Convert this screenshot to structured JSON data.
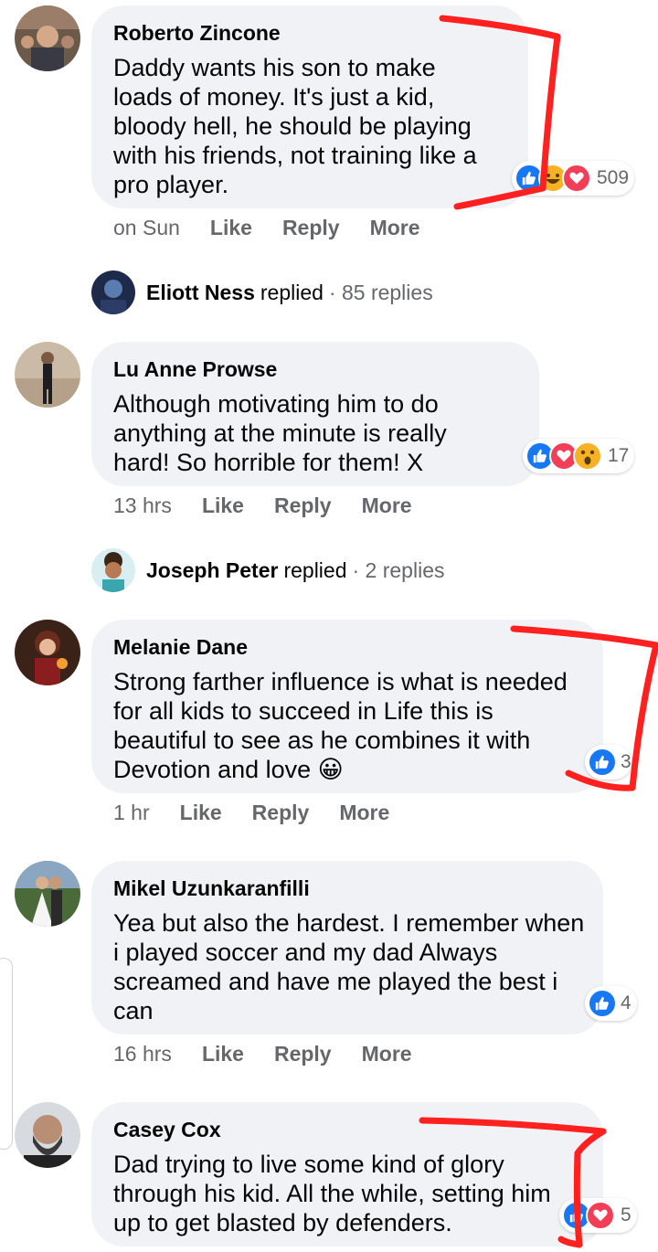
{
  "actions": {
    "like": "Like",
    "reply": "Reply",
    "more": "More"
  },
  "comments": [
    {
      "name": "Roberto Zincone",
      "text": "Daddy wants his son to make loads of money. It's just a kid, bloody hell, he should be playing with his friends, not training like a pro player.",
      "time": "on Sun",
      "reactions": [
        "like-icon",
        "haha-icon",
        "love-icon"
      ],
      "reaction_count": "509"
    },
    {
      "name": "Lu Anne Prowse",
      "text": "Although motivating him to do anything at the minute is really hard! So horrible for them! X",
      "time": "13 hrs",
      "reactions": [
        "like-icon",
        "love-icon",
        "wow-icon"
      ],
      "reaction_count": "17"
    },
    {
      "name": "Melanie Dane",
      "text": "Strong farther influence is what is needed for all kids to succeed in Life this is beautiful to see as he combines it with Devotion and love 😀",
      "time": "1 hr",
      "reactions": [
        "like-icon"
      ],
      "reaction_count": "3"
    },
    {
      "name": "Mikel Uzunkaranfilli",
      "text": "Yea but also the hardest. I remember when i played soccer and my dad Always screamed and have me played the best i can",
      "time": "16 hrs",
      "reactions": [
        "like-icon"
      ],
      "reaction_count": "4"
    },
    {
      "name": "Casey Cox",
      "text": "Dad trying to live some kind of glory through his kid. All the while, setting him up to get blasted by defenders.",
      "time": "",
      "reactions": [
        "like-icon",
        "love-icon"
      ],
      "reaction_count": "5"
    }
  ],
  "reply_summaries": [
    {
      "name": "Eliott Ness",
      "verb": "replied",
      "count": "· 85 replies"
    },
    {
      "name": "Joseph Peter",
      "verb": "replied",
      "count": "· 2 replies"
    }
  ],
  "colors": {
    "bubble": "#f0f2f5",
    "like": "#1877f2",
    "love": "#f33e58",
    "haha": "#f7b125",
    "secondary_text": "#65676b",
    "annotation": "#ff2020"
  }
}
